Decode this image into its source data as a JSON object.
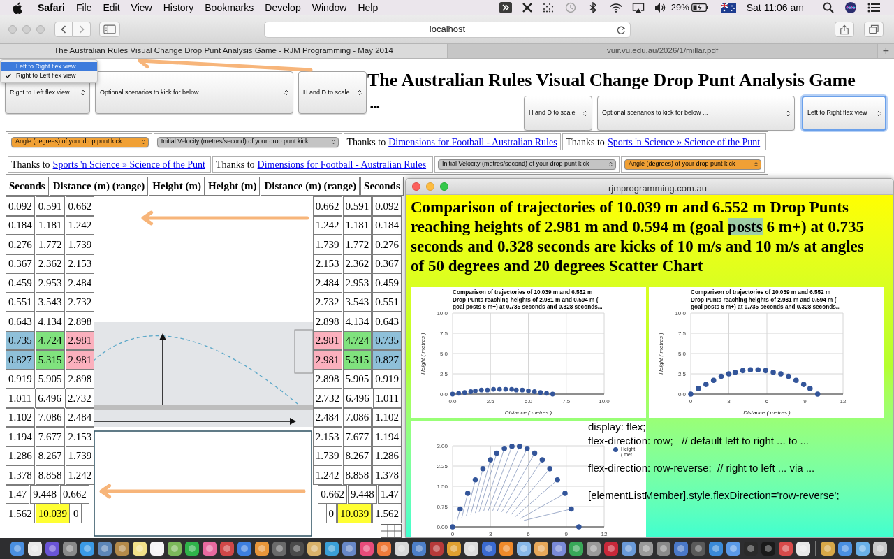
{
  "menu_bar": {
    "app": "Safari",
    "items": [
      "File",
      "Edit",
      "View",
      "History",
      "Bookmarks",
      "Develop",
      "Window",
      "Help"
    ],
    "battery": "29%",
    "clock": "Sat 11:06 am"
  },
  "browser": {
    "address": "localhost",
    "tabs": [
      {
        "title": "The Australian Rules Visual Change Drop Punt Analysis Game - RJM Programming - May 2014",
        "selected": true
      },
      {
        "title": "vuir.vu.edu.au/2026/1/millar.pdf",
        "selected": false
      }
    ],
    "new_tab": "+"
  },
  "flex_menu": [
    {
      "label": "Left to Right flex view",
      "highlighted": true,
      "checked": false
    },
    {
      "label": "Right to Left flex view",
      "highlighted": false,
      "checked": true
    }
  ],
  "left_selects": [
    {
      "value": "Right to Left flex view",
      "focused": false
    },
    {
      "value": "Optional scenarios to kick for below ...",
      "focused": false
    },
    {
      "value": "H and D to scale",
      "focused": false
    }
  ],
  "title": "The Australian Rules Visual Change Drop Punt Analysis Game",
  "ellipsis": "•••",
  "right_selects": [
    {
      "value": "H and D to scale",
      "focused": false
    },
    {
      "value": "Optional scenarios to kick for below ...",
      "focused": false
    },
    {
      "value": "Left to Right flex view",
      "focused": true
    }
  ],
  "control_rows": [
    [
      {
        "kind": "select",
        "value": "Angle (degrees) of your drop punt kick",
        "color": "#f0a035"
      },
      {
        "kind": "select",
        "value": "Initial Velocity (metres/second) of your drop punt kick",
        "color": "#c4c4c4"
      },
      {
        "kind": "credit",
        "prefix": "Thanks to",
        "link": "Dimensions for Football - Australian Rules"
      },
      {
        "kind": "credit",
        "prefix": "Thanks to",
        "link": "Sports 'n Science » Science of the Punt"
      }
    ],
    [
      {
        "kind": "credit",
        "prefix": "Thanks to",
        "link": "Sports 'n Science » Science of the Punt"
      },
      {
        "kind": "credit",
        "prefix": "Thanks to",
        "link": "Dimensions for Football - Australian Rules"
      },
      {
        "kind": "select",
        "value": "Initial Velocity (metres/second) of your drop punt kick",
        "color": "#c4c4c4"
      },
      {
        "kind": "select",
        "value": "Angle (degrees) of your drop punt kick",
        "color": "#f0a035"
      }
    ]
  ],
  "left_table": {
    "columns": [
      "Seconds",
      "Distance (m) (range)",
      "Height (m)"
    ],
    "rows": [
      [
        {
          "text": "0.092"
        },
        {
          "text": "0.591"
        },
        {
          "text": "0.662"
        }
      ],
      [
        {
          "text": "0.184"
        },
        {
          "text": "1.181"
        },
        {
          "text": "1.242"
        }
      ],
      [
        {
          "text": "0.276"
        },
        {
          "text": "1.772"
        },
        {
          "text": "1.739"
        }
      ],
      [
        {
          "text": "0.367"
        },
        {
          "text": "2.362"
        },
        {
          "text": "2.153"
        }
      ],
      [
        {
          "text": "0.459"
        },
        {
          "text": "2.953"
        },
        {
          "text": "2.484"
        }
      ],
      [
        {
          "text": "0.551"
        },
        {
          "text": "3.543"
        },
        {
          "text": "2.732"
        }
      ],
      [
        {
          "text": "0.643"
        },
        {
          "text": "4.134"
        },
        {
          "text": "2.898"
        }
      ],
      [
        {
          "text": "0.735",
          "color": "#8fc0d9"
        },
        {
          "text": "4.724",
          "color": "#80e27e"
        },
        {
          "text": "2.981",
          "color": "#fbb0bd"
        }
      ],
      [
        {
          "text": "0.827",
          "color": "#8fc0d9"
        },
        {
          "text": "5.315",
          "color": "#80e27e"
        },
        {
          "text": "2.981",
          "color": "#fbb0bd"
        }
      ],
      [
        {
          "text": "0.919"
        },
        {
          "text": "5.905"
        },
        {
          "text": "2.898"
        }
      ],
      [
        {
          "text": "1.011"
        },
        {
          "text": "6.496"
        },
        {
          "text": "2.732"
        }
      ],
      [
        {
          "text": "1.102"
        },
        {
          "text": "7.086"
        },
        {
          "text": "2.484"
        }
      ],
      [
        {
          "text": "1.194"
        },
        {
          "text": "7.677"
        },
        {
          "text": "2.153"
        }
      ],
      [
        {
          "text": "1.286"
        },
        {
          "text": "8.267"
        },
        {
          "text": "1.739"
        }
      ],
      [
        {
          "text": "1.378"
        },
        {
          "text": "8.858"
        },
        {
          "text": "1.242"
        }
      ],
      [
        {
          "text": "1.47"
        },
        {
          "text": "9.448"
        },
        {
          "text": "0.662"
        }
      ],
      [
        {
          "text": "1.562"
        },
        {
          "text": "10.039",
          "color": "#ffff33"
        },
        {
          "text": "0"
        }
      ]
    ]
  },
  "right_table": {
    "columns": [
      "Height (m)",
      "Distance (m) (range)",
      "Seconds"
    ],
    "rows": [
      [
        {
          "text": "0.662"
        },
        {
          "text": "0.591"
        },
        {
          "text": "0.092"
        }
      ],
      [
        {
          "text": "1.242"
        },
        {
          "text": "1.181"
        },
        {
          "text": "0.184"
        }
      ],
      [
        {
          "text": "1.739"
        },
        {
          "text": "1.772"
        },
        {
          "text": "0.276"
        }
      ],
      [
        {
          "text": "2.153"
        },
        {
          "text": "2.362"
        },
        {
          "text": "0.367"
        }
      ],
      [
        {
          "text": "2.484"
        },
        {
          "text": "2.953"
        },
        {
          "text": "0.459"
        }
      ],
      [
        {
          "text": "2.732"
        },
        {
          "text": "3.543"
        },
        {
          "text": "0.551"
        }
      ],
      [
        {
          "text": "2.898"
        },
        {
          "text": "4.134"
        },
        {
          "text": "0.643"
        }
      ],
      [
        {
          "text": "2.981",
          "color": "#fbb0bd"
        },
        {
          "text": "4.724",
          "color": "#80e27e"
        },
        {
          "text": "0.735",
          "color": "#8fc0d9"
        }
      ],
      [
        {
          "text": "2.981",
          "color": "#fbb0bd"
        },
        {
          "text": "5.315",
          "color": "#80e27e"
        },
        {
          "text": "0.827",
          "color": "#8fc0d9"
        }
      ],
      [
        {
          "text": "2.898"
        },
        {
          "text": "5.905"
        },
        {
          "text": "0.919"
        }
      ],
      [
        {
          "text": "2.732"
        },
        {
          "text": "6.496"
        },
        {
          "text": "1.011"
        }
      ],
      [
        {
          "text": "2.484"
        },
        {
          "text": "7.086"
        },
        {
          "text": "1.102"
        }
      ],
      [
        {
          "text": "2.153"
        },
        {
          "text": "7.677"
        },
        {
          "text": "1.194"
        }
      ],
      [
        {
          "text": "1.739"
        },
        {
          "text": "8.267"
        },
        {
          "text": "1.286"
        }
      ],
      [
        {
          "text": "1.242"
        },
        {
          "text": "8.858"
        },
        {
          "text": "1.378"
        }
      ],
      [
        {
          "text": "0.662"
        },
        {
          "text": "9.448"
        },
        {
          "text": "1.47"
        }
      ],
      [
        {
          "text": "0"
        },
        {
          "text": "10.039",
          "color": "#ffff33"
        },
        {
          "text": "1.562"
        }
      ]
    ]
  },
  "popup": {
    "title": "rjmprogramming.com.au",
    "heading": [
      {
        "text": "Comparison of trajectories of 10.039 m and 6.552 m Drop Punts reaching heights of 2.981 m and 0.594 m (goal ",
        "selected": false
      },
      {
        "text": "posts",
        "selected": true
      },
      {
        "text": " 6 m+) at 0.735 seconds and 0.328 seconds are kicks of 10 m/s and 10 m/s at angles of 50 degrees and 20 degrees Scatter Chart",
        "selected": false
      }
    ],
    "charts": [
      {
        "chart_data": {
          "type": "scatter",
          "title": "Comparison of trajectories of 10.039 m and 6.552 m Drop Punts reaching heights of 2.981 m and 0.594 m ( goal posts 6 m+) at 0.735 seconds and 0.328 seconds...",
          "xlabel": "Distance ( metres )",
          "ylabel": "Height ( metres )",
          "x": [
            0,
            0.4,
            0.8,
            1.2,
            1.5,
            1.9,
            2.3,
            2.7,
            3.1,
            3.5,
            3.9,
            4.2,
            4.6,
            5,
            5.4,
            5.8,
            6.2,
            6.6
          ],
          "series": [
            {
              "color": "#33559a",
              "values": [
                0,
                0.1,
                0.2,
                0.3,
                0.4,
                0.5,
                0.5,
                0.6,
                0.6,
                0.6,
                0.6,
                0.5,
                0.5,
                0.4,
                0.3,
                0.2,
                0.1,
                0
              ]
            }
          ],
          "xlim": [
            0,
            10
          ],
          "ylim": [
            0,
            10
          ],
          "xticks": [
            {
              "value": 0,
              "label": "0.0"
            },
            {
              "value": 2.5,
              "label": "2.5"
            },
            {
              "value": 5,
              "label": "5.0"
            },
            {
              "value": 7.5,
              "label": "7.5"
            },
            {
              "value": 10,
              "label": "10.0"
            }
          ],
          "yticks": [
            {
              "value": 0,
              "label": "0.0"
            },
            {
              "value": 2.5,
              "label": "2.5"
            },
            {
              "value": 5,
              "label": "5.0"
            },
            {
              "value": 7.5,
              "label": "7.5"
            },
            {
              "value": 10,
              "label": "10.0"
            }
          ],
          "grid": true
        }
      },
      {
        "chart_data": {
          "type": "scatter",
          "title": "Comparison of trajectories of 10.039 m and 6.552 m Drop Punts reaching heights of 2.981 m and 0.594 m ( goal posts 6 m+) at 0.735 seconds and 0.328 seconds...",
          "xlabel": "Distance ( metres )",
          "ylabel": "Height ( metres )",
          "x": [
            0,
            0.6,
            1.2,
            1.8,
            2.4,
            3,
            3.5,
            4.1,
            4.7,
            5.3,
            5.9,
            6.5,
            7.1,
            7.7,
            8.3,
            8.9,
            9.4,
            10
          ],
          "series": [
            {
              "color": "#33559a",
              "values": [
                0,
                0.7,
                1.2,
                1.7,
                2.2,
                2.5,
                2.7,
                2.9,
                3,
                3,
                2.9,
                2.7,
                2.5,
                2.2,
                1.7,
                1.2,
                0.7,
                0
              ]
            }
          ],
          "xlim": [
            0,
            12
          ],
          "ylim": [
            0,
            10
          ],
          "xticks": [
            0,
            3,
            6,
            9,
            12
          ],
          "yticks": [
            {
              "value": 0,
              "label": "0.0"
            },
            {
              "value": 2.5,
              "label": "2.5"
            },
            {
              "value": 5,
              "label": "5.0"
            },
            {
              "value": 7.5,
              "label": "7.5"
            },
            {
              "value": 10,
              "label": "10.0"
            }
          ],
          "grid": true
        }
      },
      {
        "connector_lines": true,
        "chart_data": {
          "type": "scatter",
          "x": [
            0,
            0.6,
            1.2,
            1.8,
            2.4,
            3,
            3.5,
            4.1,
            4.7,
            5.3,
            5.9,
            6.5,
            7.1,
            7.7,
            8.3,
            8.9,
            9.4,
            10
          ],
          "series": [
            {
              "name": "Height ( met...",
              "color": "#33559a",
              "values": [
                0,
                0.66,
                1.24,
                1.74,
                2.15,
                2.48,
                2.73,
                2.9,
                2.98,
                2.98,
                2.9,
                2.73,
                2.48,
                2.15,
                1.74,
                1.24,
                0.66,
                0
              ]
            }
          ],
          "xlim": [
            0,
            12
          ],
          "ylim": [
            0,
            3
          ],
          "xticks": [
            0,
            3,
            6,
            9,
            12
          ],
          "yticks": [
            {
              "value": 0,
              "label": "0.00"
            },
            {
              "value": 0.75,
              "label": "0.75"
            },
            {
              "value": 1.5,
              "label": "1.50"
            },
            {
              "value": 2.25,
              "label": "2.25"
            },
            {
              "value": 3,
              "label": "3.00"
            }
          ],
          "grid": true
        }
      }
    ],
    "code": [
      [
        "display: flex;",
        "flex-direction: row;   // default left to right ... to ..."
      ],
      [
        "flex-direction: row-reverse;  // right to left ... via ..."
      ],
      [
        "[elementListMember].style.flexDirection='row-reverse';"
      ]
    ]
  }
}
